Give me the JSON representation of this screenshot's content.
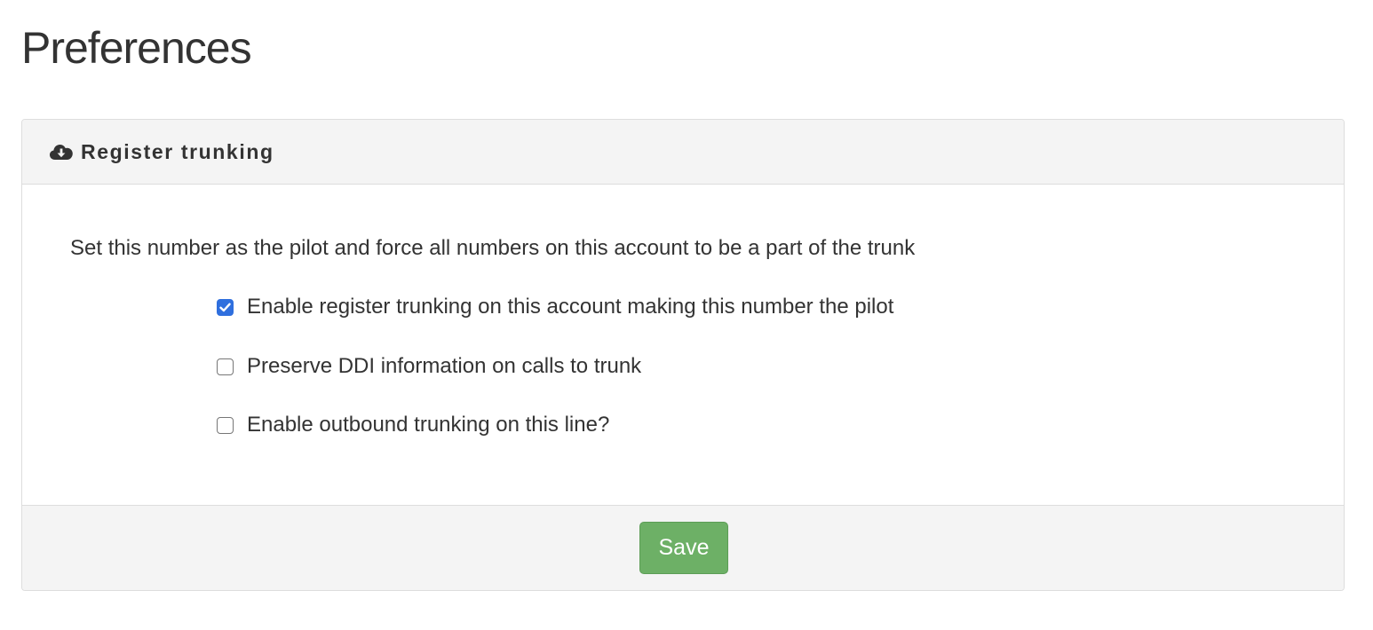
{
  "page": {
    "title": "Preferences"
  },
  "panel": {
    "icon": "cloud-download-icon",
    "heading": "Register trunking",
    "description": "Set this number as the pilot and force all numbers on this account to be a part of the trunk",
    "options": [
      {
        "label": "Enable register trunking on this account making this number the pilot",
        "checked": true
      },
      {
        "label": "Preserve DDI information on calls to trunk",
        "checked": false
      },
      {
        "label": "Enable outbound trunking on this line?",
        "checked": false
      }
    ],
    "save_label": "Save"
  },
  "colors": {
    "accent_checkbox": "#2f6fde",
    "save_button": "#6db066",
    "panel_header_bg": "#f4f4f4",
    "text": "#333333"
  }
}
